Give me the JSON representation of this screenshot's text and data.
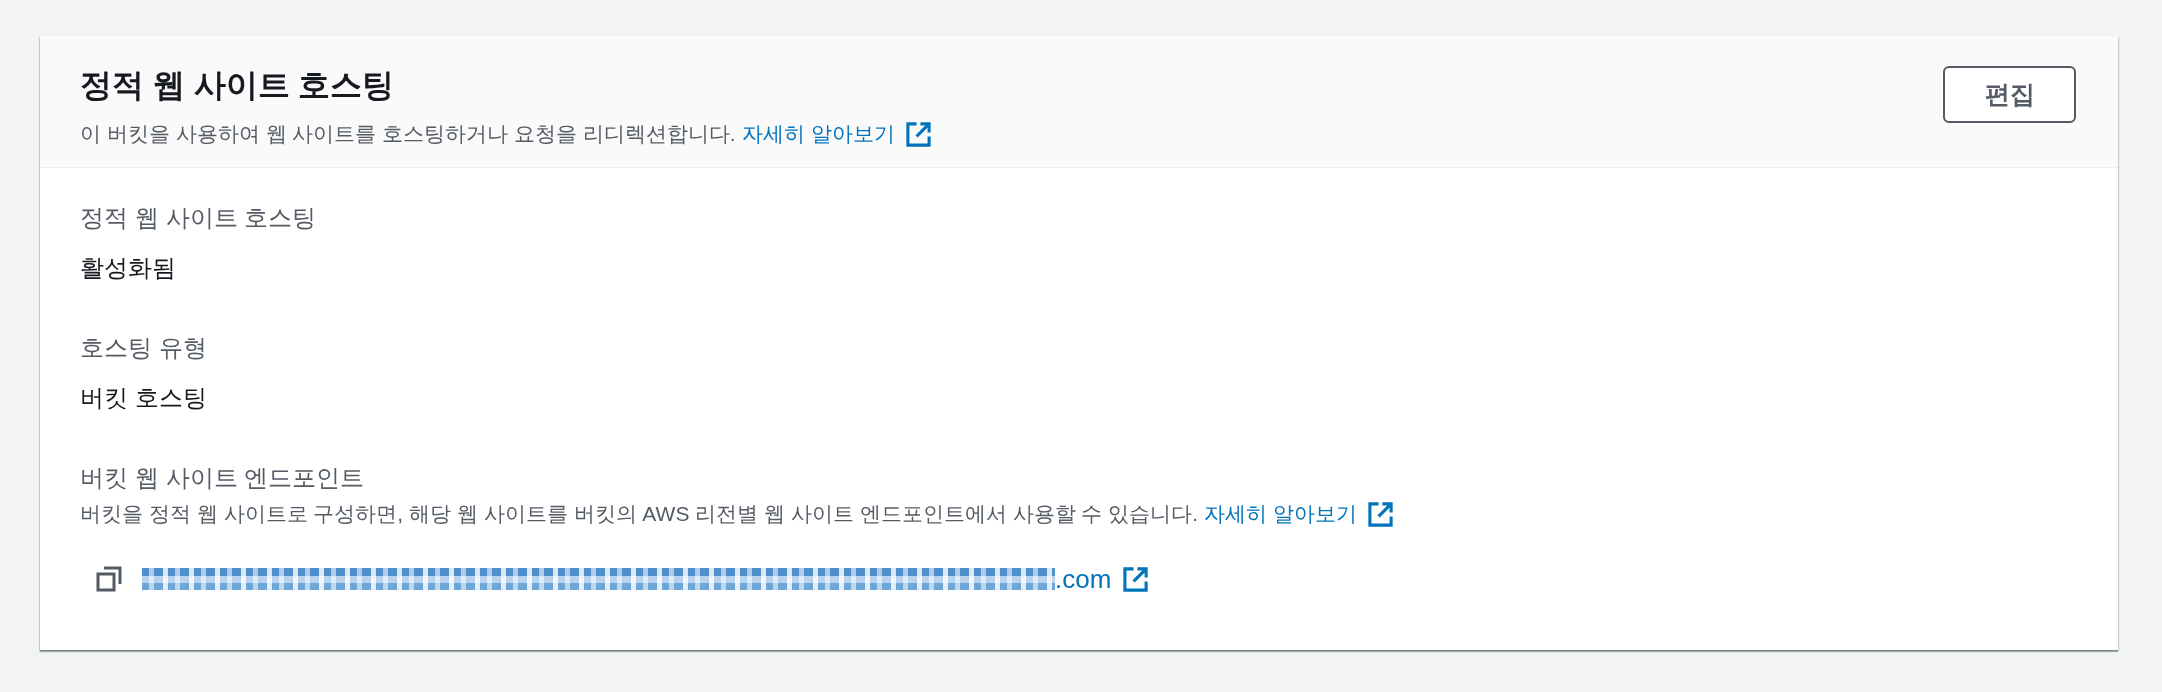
{
  "panel": {
    "title": "정적 웹 사이트 호스팅",
    "description": "이 버킷을 사용하여 웹 사이트를 호스팅하거나 요청을 리디렉션합니다.",
    "learn_more_link": "자세히 알아보기",
    "edit_button": "편집"
  },
  "fields": [
    {
      "kind": "text",
      "label": "정적 웹 사이트 호스팅",
      "value": "활성화됨"
    },
    {
      "kind": "text",
      "label": "호스팅 유형",
      "value": "버킷 호스팅"
    },
    {
      "kind": "endpoint",
      "label": "버킷 웹 사이트 엔드포인트",
      "description": "버킷을 정적 웹 사이트로 구성하면, 해당 웹 사이트를 버킷의 AWS 리전별 웹 사이트 엔드포인트에서 사용할 수 있습니다.",
      "learn_more_link": "자세히 알아보기",
      "url_visible": ".com"
    }
  ]
}
